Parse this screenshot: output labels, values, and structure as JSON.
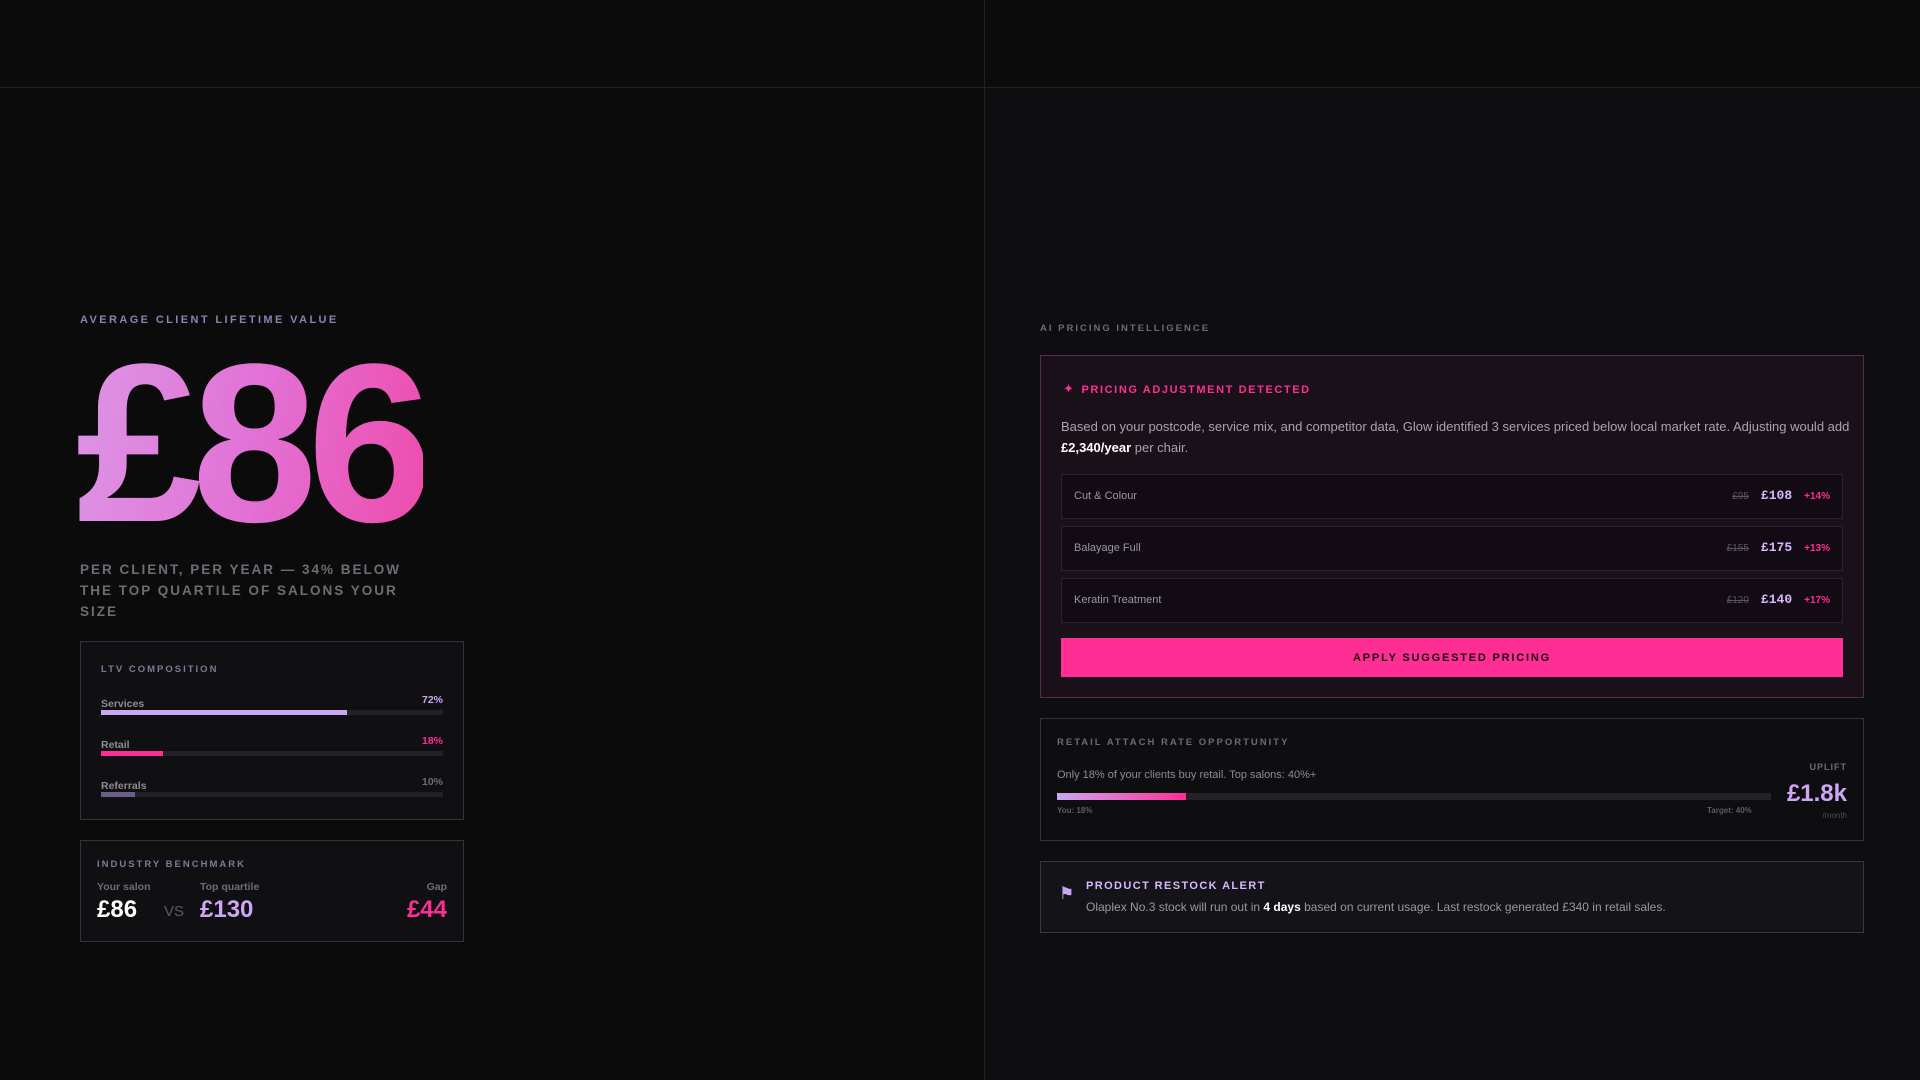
{
  "ltv": {
    "eyebrow": "AVERAGE CLIENT LIFETIME VALUE",
    "value": "£86",
    "subtitle": "PER CLIENT, PER YEAR — 34% BELOW THE TOP QUARTILE OF SALONS YOUR SIZE"
  },
  "composition": {
    "title": "LTV COMPOSITION",
    "items": [
      {
        "label": "Services",
        "pct_label": "72%",
        "value": 0.72,
        "color": "#c9a7f5"
      },
      {
        "label": "Retail",
        "pct_label": "18%",
        "value": 0.18,
        "color": "#ff2e95"
      },
      {
        "label": "Referrals",
        "pct_label": "10%",
        "value": 0.1,
        "color": "#6b5c8a"
      }
    ]
  },
  "benchmark": {
    "title": "INDUSTRY BENCHMARK",
    "your_label": "Your salon",
    "your_value": "£86",
    "vs": "VS",
    "top_label": "Top quartile",
    "top_value": "£130",
    "gap_label": "Gap",
    "gap_value": "£44"
  },
  "pricing": {
    "eyebrow": "AI PRICING INTELLIGENCE",
    "icon": "sparkle-icon",
    "heading": "PRICING ADJUSTMENT DETECTED",
    "desc_before": "Based on your postcode, service mix, and competitor data, Glow identified 3 services priced below local market rate. Adjusting would add ",
    "desc_bold": "£2,340/year",
    "desc_after": " per chair.",
    "services": [
      {
        "name": "Cut & Colour",
        "old": "£95",
        "new": "£108",
        "change": "+14%"
      },
      {
        "name": "Balayage Full",
        "old": "£155",
        "new": "£175",
        "change": "+13%"
      },
      {
        "name": "Keratin Treatment",
        "old": "£120",
        "new": "£140",
        "change": "+17%"
      }
    ],
    "apply_label": "APPLY SUGGESTED PRICING"
  },
  "retail": {
    "title": "RETAIL ATTACH RATE OPPORTUNITY",
    "desc": "Only 18% of your clients buy retail. Top salons: 40%+",
    "current_rate": 0.18,
    "you_label": "You: 18%",
    "target_label": "Target: 40%",
    "uplift_label": "UPLIFT",
    "uplift_value": "£1.8k",
    "uplift_sub": "/month"
  },
  "restock": {
    "icon": "flag-icon",
    "title": "PRODUCT RESTOCK ALERT",
    "desc_before": "Olaplex No.3 stock will run out in ",
    "desc_bold": "4 days",
    "desc_after": " based on current usage. Last restock generated £340 in retail sales."
  }
}
